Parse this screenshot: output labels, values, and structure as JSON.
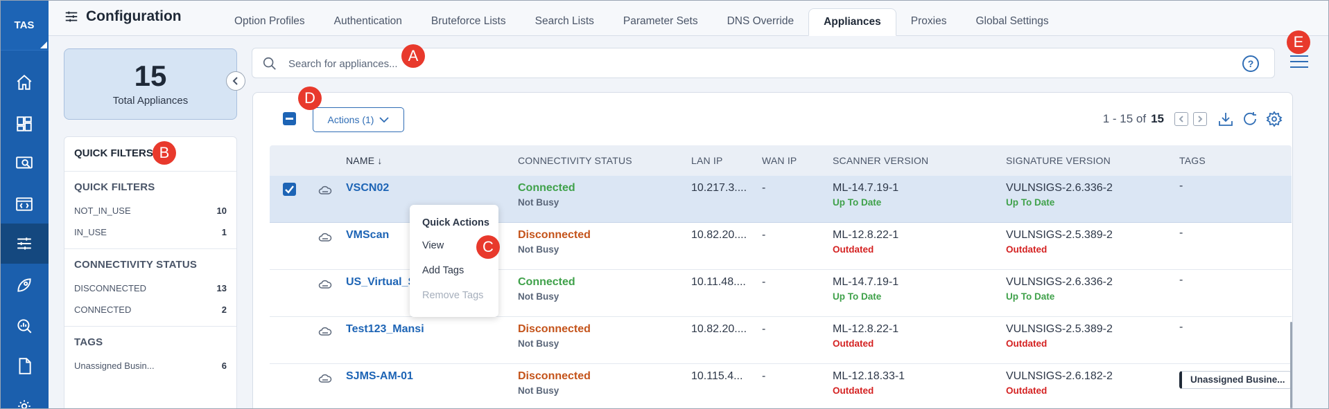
{
  "brand": "TAS",
  "header": {
    "title": "Configuration",
    "tabs": [
      "Option Profiles",
      "Authentication",
      "Bruteforce Lists",
      "Search Lists",
      "Parameter Sets",
      "DNS Override",
      "Appliances",
      "Proxies",
      "Global Settings"
    ],
    "active_tab": "Appliances"
  },
  "nav_icons": [
    "home-icon",
    "dashboard-icon",
    "scans-icon",
    "code-icon",
    "configuration-icon",
    "rocket-icon",
    "search-report-icon",
    "document-icon",
    "bulb-icon"
  ],
  "summary": {
    "count": "15",
    "label": "Total Appliances"
  },
  "quick_filters": {
    "header": "QUICK FILTERS",
    "sections": [
      {
        "title": "QUICK FILTERS",
        "items": [
          {
            "label": "NOT_IN_USE",
            "count": "10"
          },
          {
            "label": "IN_USE",
            "count": "1"
          }
        ]
      },
      {
        "title": "CONNECTIVITY STATUS",
        "items": [
          {
            "label": "DISCONNECTED",
            "count": "13"
          },
          {
            "label": "CONNECTED",
            "count": "2"
          }
        ]
      },
      {
        "title": "TAGS",
        "items": [
          {
            "label": "Unassigned Busin...",
            "count": "6"
          }
        ]
      }
    ]
  },
  "search": {
    "placeholder": "Search for appliances...",
    "value": ""
  },
  "toolbar": {
    "actions_label": "Actions (1)",
    "range": "1 - 15 of",
    "total": "15"
  },
  "table": {
    "headers": [
      "NAME",
      "CONNECTIVITY STATUS",
      "LAN IP",
      "WAN IP",
      "SCANNER VERSION",
      "SIGNATURE VERSION",
      "TAGS"
    ],
    "rows": [
      {
        "name": "VSCN02",
        "status": "Connected",
        "busy": "Not Busy",
        "lan_ip": "10.217.3....",
        "wan_ip": "-",
        "scanner": "ML-14.7.19-1",
        "scanner_state": "Up To Date",
        "signature": "VULNSIGS-2.6.336-2",
        "signature_state": "Up To Date",
        "tags": "-"
      },
      {
        "name": "VMScan",
        "status": "Disconnected",
        "busy": "Not Busy",
        "lan_ip": "10.82.20....",
        "wan_ip": "-",
        "scanner": "ML-12.8.22-1",
        "scanner_state": "Outdated",
        "signature": "VULNSIGS-2.5.389-2",
        "signature_state": "Outdated",
        "tags": "-"
      },
      {
        "name": "US_Virtual_S",
        "status": "Connected",
        "busy": "Not Busy",
        "lan_ip": "10.11.48....",
        "wan_ip": "-",
        "scanner": "ML-14.7.19-1",
        "scanner_state": "Up To Date",
        "signature": "VULNSIGS-2.6.336-2",
        "signature_state": "Up To Date",
        "tags": "-"
      },
      {
        "name": "Test123_Mansi",
        "status": "Disconnected",
        "busy": "Not Busy",
        "lan_ip": "10.82.20....",
        "wan_ip": "-",
        "scanner": "ML-12.8.22-1",
        "scanner_state": "Outdated",
        "signature": "VULNSIGS-2.5.389-2",
        "signature_state": "Outdated",
        "tags": "-"
      },
      {
        "name": "SJMS-AM-01",
        "status": "Disconnected",
        "busy": "Not Busy",
        "lan_ip": "10.115.4...",
        "wan_ip": "-",
        "scanner": "ML-12.18.33-1",
        "scanner_state": "Outdated",
        "signature": "VULNSIGS-2.6.182-2",
        "signature_state": "Outdated",
        "tags": "Unassigned Busine..."
      }
    ]
  },
  "quick_actions": {
    "title": "Quick Actions",
    "items": [
      "View",
      "Add Tags",
      "Remove Tags"
    ]
  },
  "callouts": [
    "A",
    "B",
    "C",
    "D",
    "E"
  ],
  "colors": {
    "nav": "#1b5fad",
    "accent": "#1d64b5",
    "connected": "#3fa14a",
    "disconnected": "#c4531a",
    "outdated": "#d42222",
    "callout": "#e8392c"
  }
}
